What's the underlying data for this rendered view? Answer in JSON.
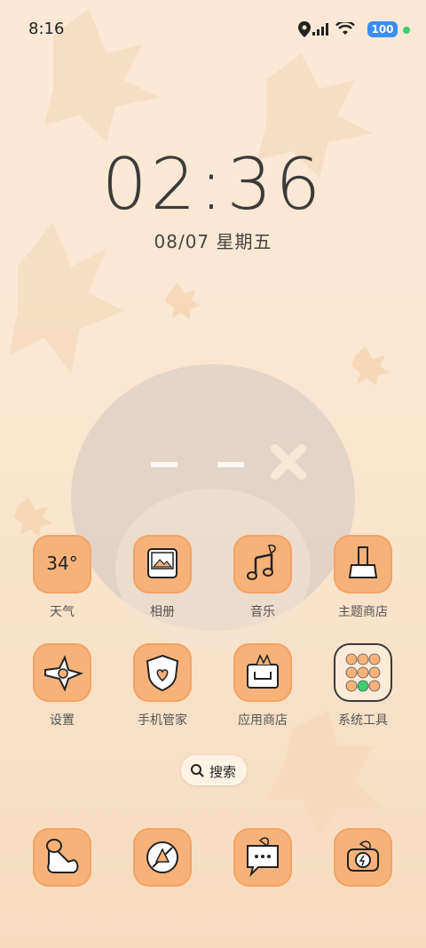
{
  "status": {
    "time": "8:16",
    "battery": "100"
  },
  "clock": {
    "time": "02:36",
    "date": "08/07 星期五"
  },
  "apps": [
    {
      "label": "天气",
      "temp": "34°"
    },
    {
      "label": "相册"
    },
    {
      "label": "音乐"
    },
    {
      "label": "主题商店"
    },
    {
      "label": "设置"
    },
    {
      "label": "手机管家"
    },
    {
      "label": "应用商店"
    },
    {
      "label": "系统工具"
    }
  ],
  "search": {
    "label": "搜索"
  },
  "colors": {
    "tile": "#f7b27a",
    "tile_border": "#f3a466",
    "battery": "#3b8cf3"
  }
}
